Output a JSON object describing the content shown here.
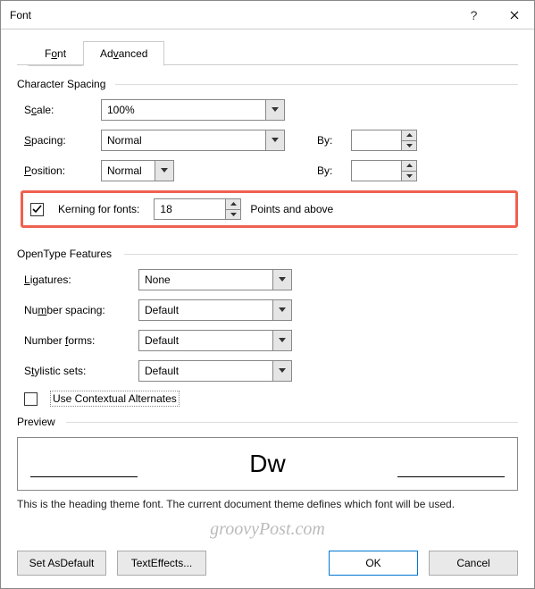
{
  "titlebar": {
    "title": "Font"
  },
  "tabs": {
    "font": "Font",
    "advanced": "Advanced"
  },
  "group_char": {
    "title": "Character Spacing",
    "scale_label": "Scale:",
    "scale_value": "100%",
    "spacing_label": "Spacing:",
    "spacing_value": "Normal",
    "position_label": "Position:",
    "position_value": "Normal",
    "by_label": "By:",
    "kerning_label": "Kerning for fonts:",
    "kerning_value": "18",
    "kerning_suffix": "Points and above"
  },
  "group_open": {
    "title": "OpenType Features",
    "ligatures_label": "Ligatures:",
    "ligatures_value": "None",
    "numspacing_label": "Number spacing:",
    "numspacing_value": "Default",
    "numforms_label": "Number forms:",
    "numforms_value": "Default",
    "stylistic_label": "Stylistic sets:",
    "stylistic_value": "Default",
    "contextual_label": "Use Contextual Alternates"
  },
  "preview": {
    "title": "Preview",
    "sample": "Dw",
    "description": "This is the heading theme font. The current document theme defines which font will be used."
  },
  "footer": {
    "set_default": "Set As Default",
    "text_effects": "Text Effects...",
    "ok": "OK",
    "cancel": "Cancel"
  },
  "watermark": "groovyPost.com"
}
